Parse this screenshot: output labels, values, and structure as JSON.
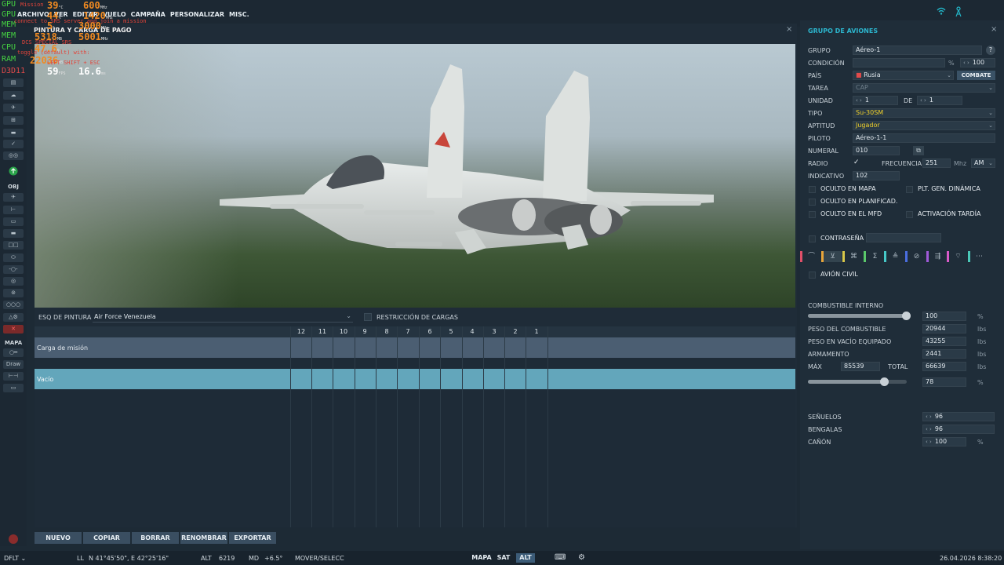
{
  "menu": {
    "items": [
      "ARCHIVO",
      "VER",
      "EDITAR",
      "VUELO",
      "CAMPAÑA",
      "PERSONALIZAR",
      "MISC."
    ]
  },
  "overlay": {
    "rows": [
      {
        "label": "GPU",
        "value": "39",
        "unit": "°C",
        "value2": "600",
        "unit2": "MHz"
      },
      {
        "label": "GPU",
        "value": "44",
        "unit": "%",
        "value2": "1420",
        "unit2": "MHz"
      },
      {
        "label": "MEM",
        "value": "5",
        "unit": "%",
        "value2": "3000",
        "unit2": "MHz"
      },
      {
        "label": "MEM",
        "value": "5318",
        "unit": "MB",
        "value2": "5001",
        "unit2": "MHz"
      },
      {
        "label": "CPU",
        "value": "47.6",
        "unit": "%",
        "value2": "",
        "unit2": ""
      },
      {
        "label": "RAM",
        "value": "22036",
        "unit": "MB",
        "value2": "",
        "unit2": ""
      }
    ],
    "api_label": "D3D11",
    "fps": "59",
    "fps_unit": "FPS",
    "frametime": "16.6",
    "frametime_unit": "ms",
    "red_lines": [
      "Mission",
      "connect to SRS server and join a mission",
      "DCS SPECIAL SRS",
      "toggle (default) with:",
      "LEFT SHIFT + ESC"
    ]
  },
  "left_tools": {
    "obj_label": "OBJ",
    "map_label": "MAPA",
    "draw_label": "Draw"
  },
  "center": {
    "title": "PINTURA Y CARGA DE PAGO",
    "close_glyph": "×",
    "painting_label": "ESQ DE PINTURA",
    "painting_value": "Air Force Venezuela",
    "restriction_label": "RESTRICCIÓN DE CARGAS",
    "stations": [
      "12",
      "11",
      "10",
      "9",
      "8",
      "7",
      "6",
      "5",
      "4",
      "3",
      "2",
      "1"
    ],
    "rows": [
      {
        "label": "Carga de misión"
      },
      {
        "label": "Vacío"
      }
    ],
    "buttons": [
      "NUEVO",
      "COPIAR",
      "BORRAR",
      "RENOMBRAR",
      "EXPORTAR"
    ]
  },
  "group": {
    "title": "GRUPO DE AVIONES",
    "close_glyph": "×",
    "help_glyph": "?",
    "labels": {
      "grupo": "GRUPO",
      "condicion": "CONDICIÓN",
      "pais": "PAÍS",
      "tarea": "TAREA",
      "unidad": "UNIDAD",
      "de": "DE",
      "tipo": "TIPO",
      "aptitud": "APTITUD",
      "piloto": "PILOTO",
      "numeral": "NUMERAL",
      "radio": "RADIO",
      "frecuencia": "FRECUENCIA",
      "mhz": "Mhz",
      "indicativo": "INDICATIVO"
    },
    "values": {
      "grupo": "Aéreo-1",
      "condicion_unit": "%",
      "condicion": "100",
      "pais": "Rusia",
      "combate": "COMBATE",
      "tarea": "CAP",
      "unidad": "1",
      "unidad_de": "1",
      "tipo": "Su-30SM",
      "aptitud": "Jugador",
      "piloto": "Aéreo-1-1",
      "numeral": "010",
      "frecuencia": "251",
      "modulacion": "AM",
      "indicativo": "102"
    },
    "checkboxes": {
      "oculto_mapa": "OCULTO EN MAPA",
      "oculto_planificad": "OCULTO EN PLANIFICAD.",
      "oculto_mfd": "OCULTO EN EL MFD",
      "plt_gen": "PLT. GEN. DINÁMICA",
      "activacion": "ACTIVACIÓN TARDÍA",
      "contrasena": "CONTRASEÑA",
      "avion_civil": "AVIÓN CIVIL"
    },
    "tab_colors": [
      "#e0506a",
      "#e8a53a",
      "#d8c84a",
      "#5ac86a",
      "#46c8c8",
      "#4a6ee0",
      "#a05ad8",
      "#d85ac8",
      "#4ac8b8"
    ],
    "tab_icons": [
      "route-icon",
      "payload-icon",
      "triggers-icon",
      "summary-icon",
      "fuel-icon",
      "disabled-icon",
      "advanced-icon",
      "radio-icon",
      "more-icon"
    ],
    "tab_glyphs": [
      "⌒",
      "⊻",
      "⌘",
      "Σ",
      "≜",
      "⊘",
      "⇶",
      "⌔",
      "⋯"
    ]
  },
  "fuel": {
    "combustible_interno": "COMBUSTIBLE INTERNO",
    "combustible_pct": "100",
    "pct_unit": "%",
    "peso_combustible_label": "PESO DEL COMBUSTIBLE",
    "peso_combustible": "20944",
    "peso_vacio_label": "PESO EN VACÍO EQUIPADO",
    "peso_vacio": "43255",
    "armamento_label": "ARMAMENTO",
    "armamento": "2441",
    "max_label": "MÁX",
    "max": "85539",
    "total_label": "TOTAL",
    "total": "66639",
    "lbs": "lbs",
    "load_pct": "78",
    "fuel_level": 1.0,
    "load_level": 0.78,
    "senuelos_label": "SEÑUELOS",
    "senuelos": "96",
    "bengalas_label": "BENGALAS",
    "bengalas": "96",
    "canon_label": "CAÑÓN",
    "canon": "100"
  },
  "status": {
    "profile": "DFLT",
    "ll_label": "LL",
    "ll": "N 41°45'50\", E 42°25'16\"",
    "alt_label": "ALT",
    "alt": "6219",
    "md_label": "MD",
    "md": "+6.5°",
    "mode": "MOVER/SELECC",
    "map_buttons": [
      "MAPA",
      "SAT",
      "ALT"
    ],
    "datetime": "26.04.2026 8:38:20"
  }
}
